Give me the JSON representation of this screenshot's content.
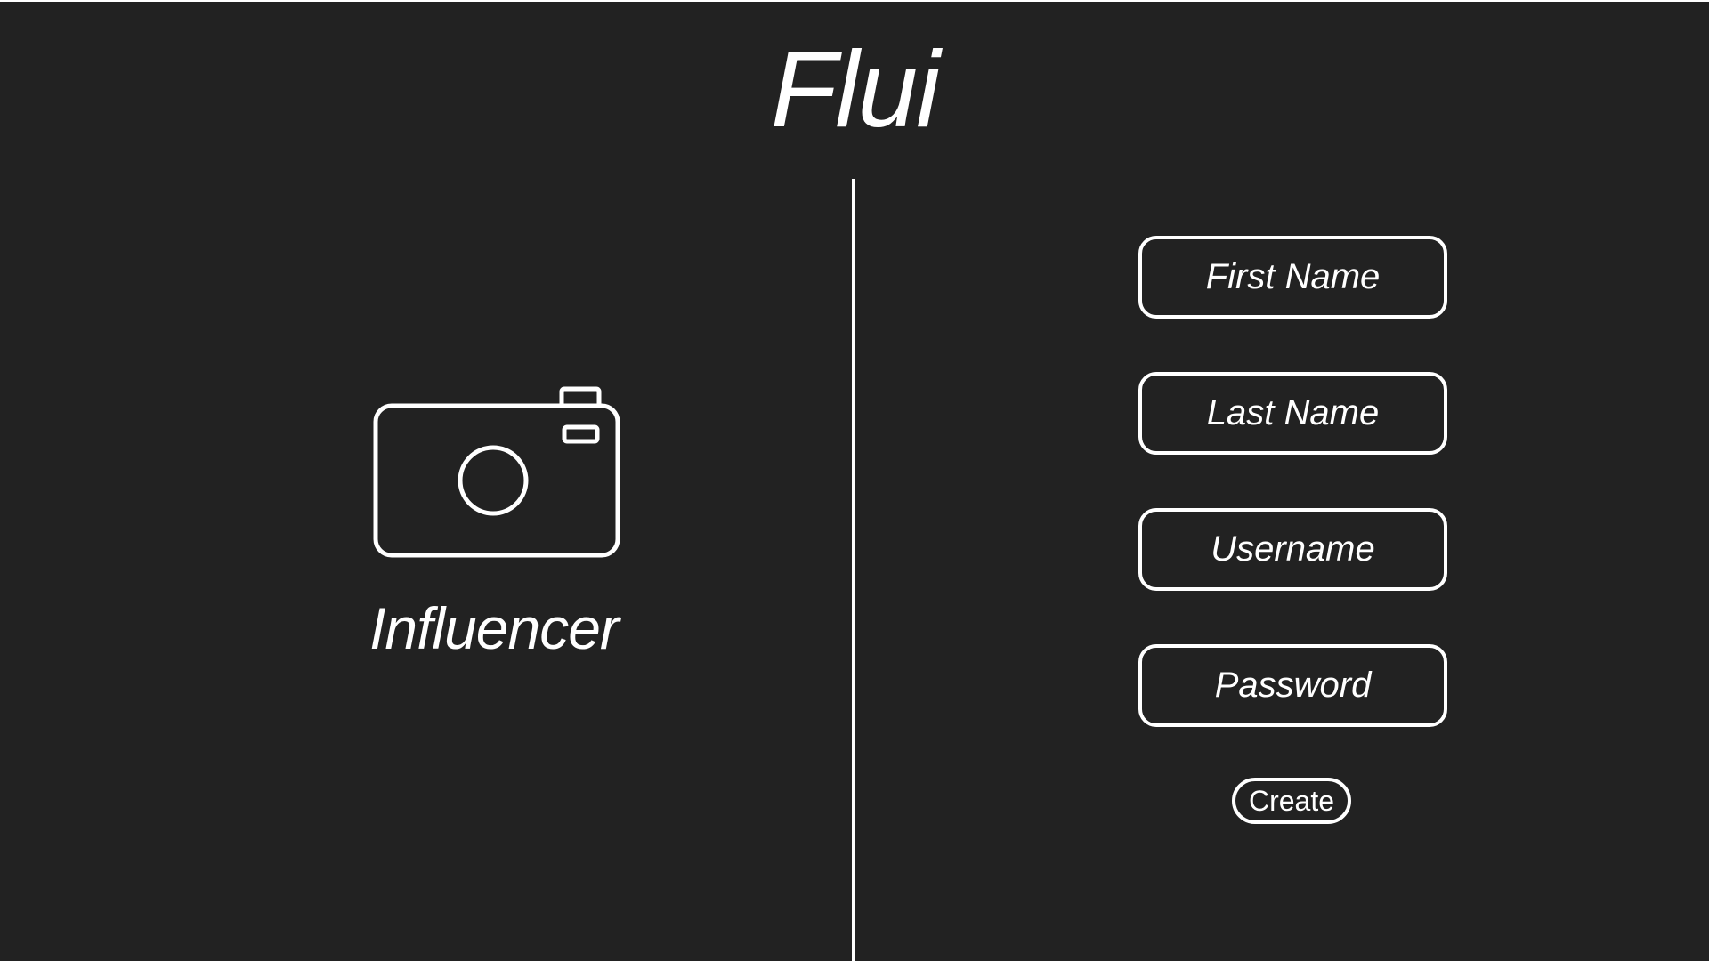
{
  "app": {
    "title": "Flui"
  },
  "role": {
    "label": "Influencer",
    "icon": "camera-icon"
  },
  "form": {
    "first_name_placeholder": "First Name",
    "last_name_placeholder": "Last Name",
    "username_placeholder": "Username",
    "password_placeholder": "Password",
    "create_label": "Create"
  },
  "colors": {
    "background": "#222222",
    "foreground": "#ffffff"
  }
}
